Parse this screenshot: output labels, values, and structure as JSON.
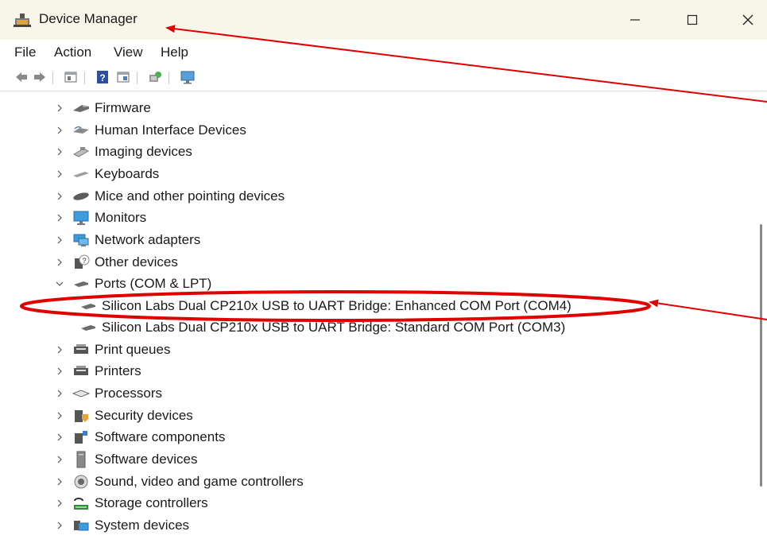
{
  "window": {
    "title": "Device Manager",
    "controls": [
      "minimize",
      "maximize",
      "close"
    ]
  },
  "menu": [
    "File",
    "Action",
    "View",
    "Help"
  ],
  "toolbar": [
    "back-icon",
    "forward-icon",
    "properties-icon",
    "help-icon",
    "show-hidden-icon",
    "scan-hardware-icon",
    "display-icon"
  ],
  "tree": [
    {
      "label": "Firmware",
      "state": "collapsed",
      "icon": "firmware-icon"
    },
    {
      "label": "Human Interface Devices",
      "state": "collapsed",
      "icon": "hid-icon"
    },
    {
      "label": "Imaging devices",
      "state": "collapsed",
      "icon": "imaging-icon"
    },
    {
      "label": "Keyboards",
      "state": "collapsed",
      "icon": "keyboard-icon"
    },
    {
      "label": "Mice and other pointing devices",
      "state": "collapsed",
      "icon": "mouse-icon"
    },
    {
      "label": "Monitors",
      "state": "collapsed",
      "icon": "monitor-icon"
    },
    {
      "label": "Network adapters",
      "state": "collapsed",
      "icon": "network-icon"
    },
    {
      "label": "Other devices",
      "state": "collapsed",
      "icon": "unknown-device-icon"
    },
    {
      "label": "Ports (COM & LPT)",
      "state": "expanded",
      "icon": "port-icon"
    },
    {
      "label": "Silicon Labs Dual CP210x USB to UART Bridge: Enhanced COM Port (COM4)",
      "state": "child",
      "icon": "port-icon"
    },
    {
      "label": "Silicon Labs Dual CP210x USB to UART Bridge: Standard COM Port (COM3)",
      "state": "child",
      "icon": "port-icon"
    },
    {
      "label": "Print queues",
      "state": "collapsed",
      "icon": "printer-icon"
    },
    {
      "label": "Printers",
      "state": "collapsed",
      "icon": "printer-icon"
    },
    {
      "label": "Processors",
      "state": "collapsed",
      "icon": "processor-icon"
    },
    {
      "label": "Security devices",
      "state": "collapsed",
      "icon": "security-icon"
    },
    {
      "label": "Software components",
      "state": "collapsed",
      "icon": "software-component-icon"
    },
    {
      "label": "Software devices",
      "state": "collapsed",
      "icon": "software-device-icon"
    },
    {
      "label": "Sound, video and game controllers",
      "state": "collapsed",
      "icon": "sound-icon"
    },
    {
      "label": "Storage controllers",
      "state": "collapsed",
      "icon": "storage-icon"
    },
    {
      "label": "System devices",
      "state": "collapsed",
      "icon": "system-icon"
    }
  ],
  "annotations": {
    "color": "#e00000",
    "highlighted_item": "Silicon Labs Dual CP210x USB to UART Bridge: Enhanced COM Port (COM4)"
  }
}
